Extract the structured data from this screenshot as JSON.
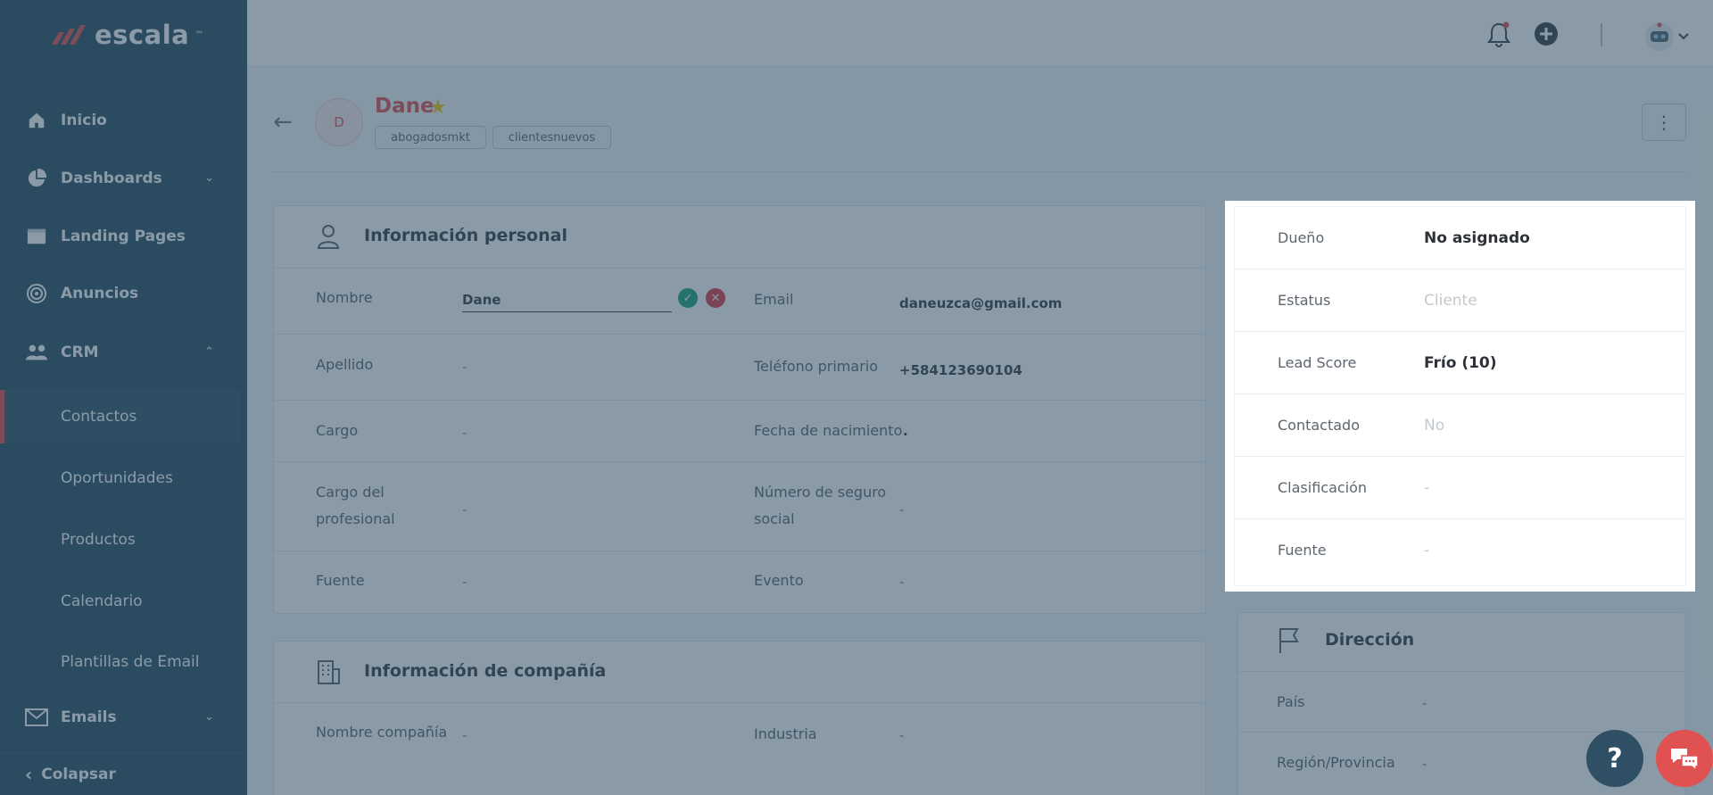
{
  "brand": {
    "name": "escala",
    "tm": "™",
    "accent": "#e05252",
    "sidebar_bg": "#2e4f64"
  },
  "sidebar": {
    "items": [
      {
        "label": "Inicio",
        "icon": "home-icon"
      },
      {
        "label": "Dashboards",
        "icon": "pie-chart-icon"
      },
      {
        "label": "Landing Pages",
        "icon": "browser-window-icon"
      },
      {
        "label": "Anuncios",
        "icon": "target-icon"
      },
      {
        "label": "CRM",
        "icon": "users-icon"
      },
      {
        "label": "Emails",
        "icon": "envelope-icon"
      }
    ],
    "crm_subitems": [
      {
        "label": "Contactos",
        "active": true
      },
      {
        "label": "Oportunidades"
      },
      {
        "label": "Productos"
      },
      {
        "label": "Calendario"
      },
      {
        "label": "Plantillas de Email"
      }
    ],
    "collapse_label": "Colapsar"
  },
  "contact": {
    "initial": "D",
    "name": "Dane",
    "tags": [
      "abogadosmkt",
      "clientesnuevos"
    ]
  },
  "personal": {
    "title": "Información personal",
    "nombre_label": "Nombre",
    "nombre_value": "Dane",
    "apellido_label": "Apellido",
    "apellido_value": "-",
    "cargo_label": "Cargo",
    "cargo_value": "-",
    "cargo_prof_label_1": "Cargo del",
    "cargo_prof_label_2": "profesional",
    "cargo_prof_value": "-",
    "fuente_label": "Fuente",
    "fuente_value": "-",
    "email_label": "Email",
    "email_value": "daneuzca@gmail.com",
    "telefono_label": "Teléfono primario",
    "telefono_value": "+584123690104",
    "fecha_label": "Fecha de nacimiento",
    "fecha_value": ".",
    "nss_label_1": "Número de seguro",
    "nss_label_2": "social",
    "nss_value": "-",
    "evento_label": "Evento",
    "evento_value": "-"
  },
  "company": {
    "title": "Información de compañía",
    "nombre_label": "Nombre compañía",
    "nombre_value": "-",
    "industria_label": "Industria",
    "industria_value": "-"
  },
  "summary": {
    "rows": [
      {
        "label": "Dueño",
        "value": "No asignado"
      },
      {
        "label": "Estatus",
        "value": "Cliente"
      },
      {
        "label": "Lead Score",
        "value": "Frío (10)"
      },
      {
        "label": "Contactado",
        "value": "No"
      },
      {
        "label": "Clasificación",
        "value": "-"
      },
      {
        "label": "Fuente",
        "value": "-"
      }
    ]
  },
  "address": {
    "title": "Dirección",
    "pais_label": "País",
    "pais_value": "-",
    "region_label": "Región/Provincia",
    "region_value": "-"
  },
  "help_label": "?"
}
